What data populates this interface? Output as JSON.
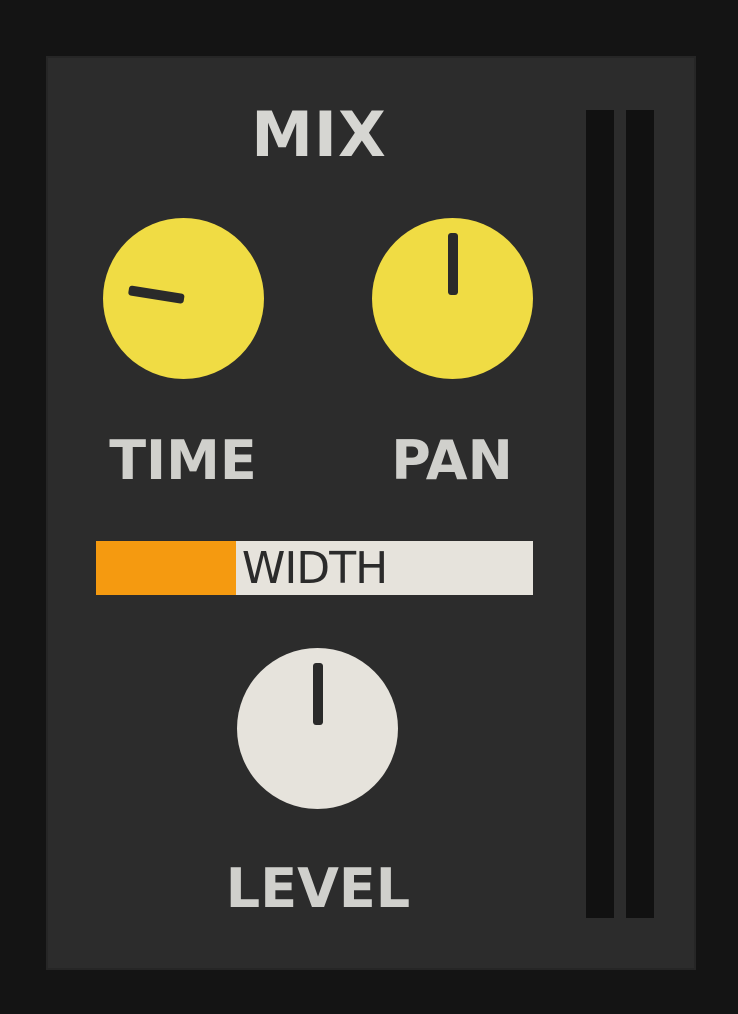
{
  "section": {
    "title": "MIX"
  },
  "knobs": {
    "time": {
      "label": "TIME",
      "color": "#f0dc44",
      "value": 0.2
    },
    "pan": {
      "label": "PAN",
      "color": "#f0dc44",
      "value": 0.5
    },
    "level": {
      "label": "LEVEL",
      "color": "#e6e3dc",
      "value": 0.5
    }
  },
  "width": {
    "label": "WIDTH",
    "value": 0.32,
    "fill_color": "#f59a10"
  },
  "meter": {
    "left_level": 0,
    "right_level": 0
  }
}
